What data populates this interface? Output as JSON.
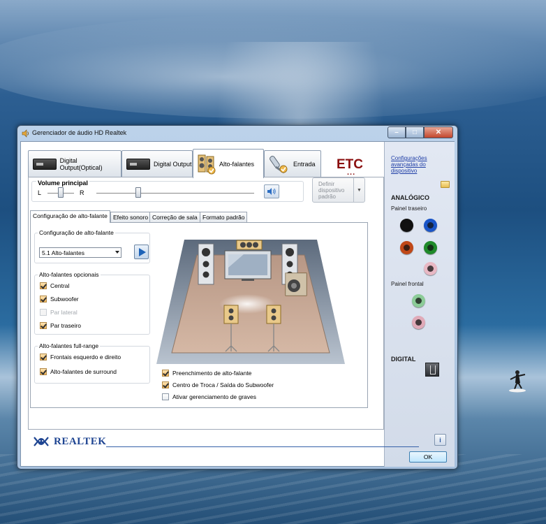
{
  "window": {
    "title": "Gerenciador de áudio HD Realtek",
    "controls": {
      "minimize": "–",
      "maximize": "□",
      "close": "✕"
    }
  },
  "tabs": [
    {
      "label": "Digital Output(Optical)",
      "icon": "optical-device-icon"
    },
    {
      "label": "Digital Output",
      "icon": "digital-device-icon"
    },
    {
      "label": "Alto-falantes",
      "icon": "speakers-icon",
      "active": true
    },
    {
      "label": "Entrada",
      "icon": "microphone-icon"
    }
  ],
  "etc_logo": "ETC",
  "etc_dots": "...",
  "volume": {
    "title": "Volume principal",
    "left_label": "L",
    "right_label": "R",
    "balance": 0.5,
    "level": 0.27
  },
  "default_device_button": "Definir dispositivo padrão",
  "sub_tabs": [
    {
      "label": "Configuração de alto-falante",
      "active": true
    },
    {
      "label": "Efeito sonoro"
    },
    {
      "label": "Correção de sala"
    },
    {
      "label": "Formato padrão"
    }
  ],
  "speaker_config": {
    "group_title": "Configuração de alto-falante",
    "selected": "5.1 Alto-falantes"
  },
  "optional_speakers": {
    "title": "Alto-falantes opcionais",
    "items": [
      {
        "label": "Central",
        "checked": true,
        "enabled": true
      },
      {
        "label": "Subwoofer",
        "checked": true,
        "enabled": true
      },
      {
        "label": "Par lateral",
        "checked": false,
        "enabled": false
      },
      {
        "label": "Par traseiro",
        "checked": true,
        "enabled": true
      }
    ]
  },
  "fullrange": {
    "title": "Alto-falantes full-range",
    "items": [
      {
        "label": "Frontais esquerdo e direito",
        "checked": true
      },
      {
        "label": "Alto-falantes de surround",
        "checked": true
      }
    ]
  },
  "room_options": [
    {
      "label": "Preenchimento de alto-falante",
      "checked": true
    },
    {
      "label": "Centro de Troca / Saída do Subwoofer",
      "checked": true
    },
    {
      "label": "Ativar gerenciamento de graves",
      "checked": false
    }
  ],
  "side": {
    "link": "Configurações avançadas do dispositivo",
    "analog": "ANALÓGICO",
    "rear_panel": "Painel traseiro",
    "front_panel": "Painel frontal",
    "digital": "DIGITAL",
    "rear_jacks": [
      "#101010",
      "#1a55c8",
      "#c04818",
      "#1f8a2a",
      "#e8b8c4"
    ],
    "front_jacks": [
      "#8ccc98",
      "#e0aab8"
    ]
  },
  "footer": {
    "brand": "REALTEK",
    "info": "i",
    "ok": "OK"
  },
  "colors": {
    "accent": "#1f4592",
    "etc": "#8b0f0f",
    "checkbox_on": "#f1b75d"
  }
}
